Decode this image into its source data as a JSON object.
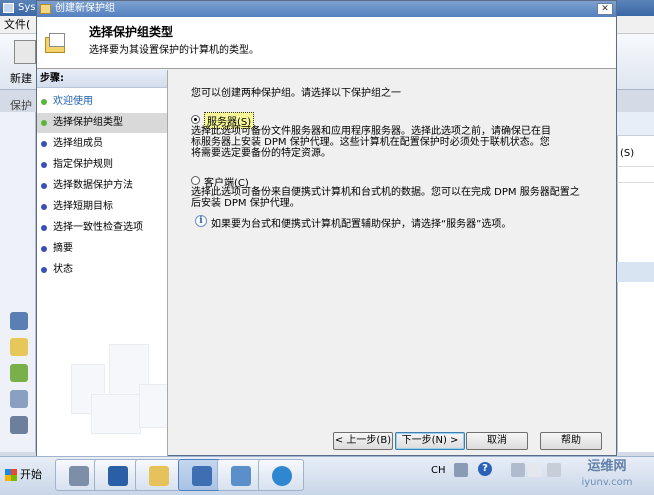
{
  "background_app": {
    "title": "Sys",
    "menu_file": "文件(",
    "new_label": "新建",
    "protect_tab": "保护",
    "column_s": "(S)"
  },
  "dialog": {
    "title": "创建新保护组",
    "close_glyph": "✕",
    "header": {
      "title": "选择保护组类型",
      "subtitle": "选择要为其设置保护的计算机的类型。"
    },
    "steps_heading": "步骤:",
    "steps": [
      {
        "label": "欢迎使用",
        "state": "done"
      },
      {
        "label": "选择保护组类型",
        "state": "current"
      },
      {
        "label": "选择组成员",
        "state": "pending"
      },
      {
        "label": "指定保护规则",
        "state": "pending"
      },
      {
        "label": "选择数据保护方法",
        "state": "pending"
      },
      {
        "label": "选择短期目标",
        "state": "pending"
      },
      {
        "label": "选择一致性检查选项",
        "state": "pending"
      },
      {
        "label": "摘要",
        "state": "pending"
      },
      {
        "label": "状态",
        "state": "pending"
      }
    ],
    "content": {
      "intro": "您可以创建两种保护组。请选择以下保护组之一",
      "server_option": {
        "label": "服务器(S)",
        "checked": true,
        "description": "选择此选项可备份文件服务器和应用程序服务器。选择此选项之前，请确保已在目标服务器上安装 DPM 保护代理。这些计算机在配置保护时必须处于联机状态。您将需要选定要备份的特定资源。"
      },
      "client_option": {
        "label": "客户端(C)",
        "checked": false,
        "description": "选择此选项可备份来自便携式计算机和台式机的数据。您可以在完成 DPM 服务器配置之后安装 DPM 保护代理。"
      },
      "info_glyph": "i",
      "info_text": "如果要为台式和便携式计算机配置辅助保护，请选择“服务器”选项。"
    },
    "buttons": {
      "back": "< 上一步(B)",
      "next": "下一步(N) >",
      "cancel": "取消",
      "help": "帮助"
    }
  },
  "taskbar": {
    "start_label": "开始",
    "tray_lang": "CH",
    "tray_help_glyph": "?"
  },
  "watermark": {
    "line1": "运维网",
    "line2": "iyunv.com"
  },
  "colors": {
    "title_bar": "#5481bf",
    "step_done_dot": "#59b63a",
    "step_pending_dot": "#3a4fb8",
    "selected_option_highlight": "#f7f79a"
  }
}
